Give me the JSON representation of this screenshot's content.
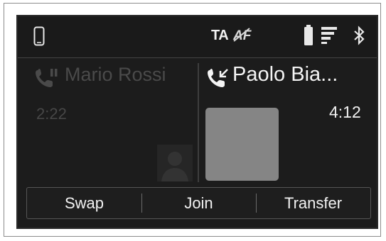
{
  "status": {
    "ta": "TA",
    "af": "AF"
  },
  "held_call": {
    "name": "Mario Rossi",
    "duration": "2:22"
  },
  "active_call": {
    "name": "Paolo Bia...",
    "duration": "4:12"
  },
  "buttons": {
    "swap": "Swap",
    "join": "Join",
    "transfer": "Transfer"
  },
  "colors": {
    "screen_bg": "#1c1c1c",
    "held_text": "#4a4a4a",
    "active_text": "#f4f4f4",
    "avatar_placeholder": "#858585"
  }
}
